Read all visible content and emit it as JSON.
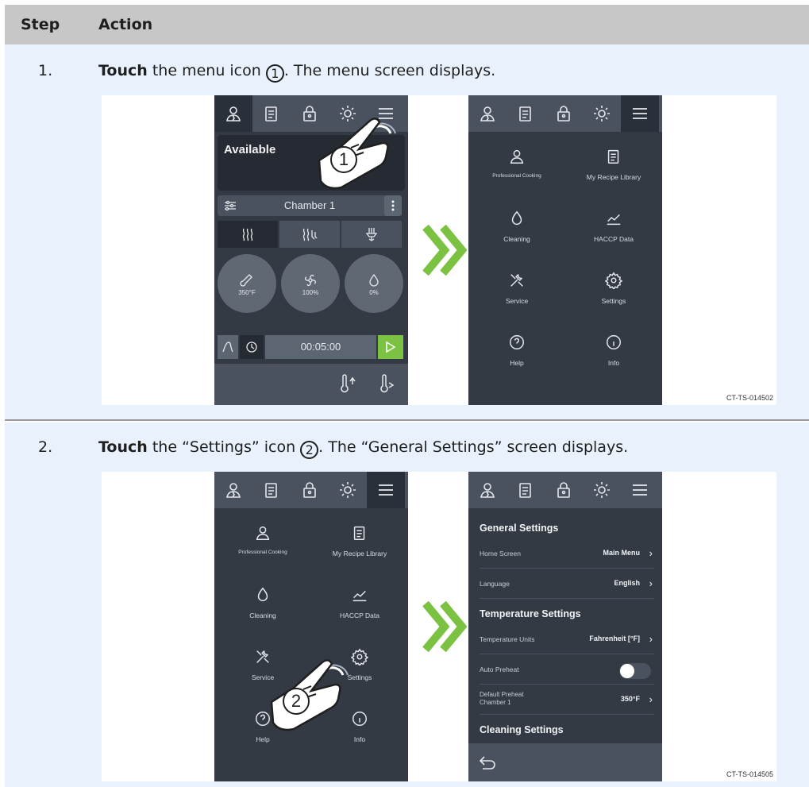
{
  "table": {
    "header_step": "Step",
    "header_action": "Action"
  },
  "steps": [
    {
      "number": "1.",
      "verb": "Touch",
      "text_a": " the menu icon ",
      "callout": "1",
      "text_b": ". The menu screen displays.",
      "figure_id": "CT-TS-014502"
    },
    {
      "number": "2.",
      "verb": "Touch",
      "text_a": " the “Settings” icon ",
      "callout": "2",
      "text_b": ". The “General Settings” screen displays.",
      "figure_id": "CT-TS-014505"
    }
  ],
  "home_screen": {
    "status": "Available",
    "chamber": "Chamber 1",
    "dial_temp": "350°F",
    "dial_fan": "100%",
    "dial_humidity": "0%",
    "timer": "00:05:00",
    "callout": "1"
  },
  "menu_screen": {
    "items": [
      {
        "label": "Professional Cooking",
        "icon": "chef-icon"
      },
      {
        "label": "My Recipe Library",
        "icon": "recipe-book-icon"
      },
      {
        "label": "Cleaning",
        "icon": "drop-icon"
      },
      {
        "label": "HACCP Data",
        "icon": "chart-icon"
      },
      {
        "label": "Service",
        "icon": "tools-icon"
      },
      {
        "label": "Settings",
        "icon": "gear-icon"
      },
      {
        "label": "Help",
        "icon": "help-icon"
      },
      {
        "label": "Info",
        "icon": "info-icon"
      }
    ],
    "callout": "2"
  },
  "settings_screen": {
    "general_title": "General Settings",
    "home_screen_label": "Home Screen",
    "home_screen_value": "Main Menu",
    "language_label": "Language",
    "language_value": "English",
    "temperature_title": "Temperature Settings",
    "units_label": "Temperature Units",
    "units_value": "Fahrenheit [°F]",
    "auto_preheat_label": "Auto Preheat",
    "default_preheat_label": "Default Preheat Chamber 1",
    "default_preheat_value": "350°F",
    "cleaning_title": "Cleaning Settings"
  },
  "colors": {
    "panel": "#333a44",
    "bar": "#49525e",
    "accent_green": "#7cc242",
    "row_bg": "#e9f1fc",
    "header_bg": "#c7c7c7"
  }
}
